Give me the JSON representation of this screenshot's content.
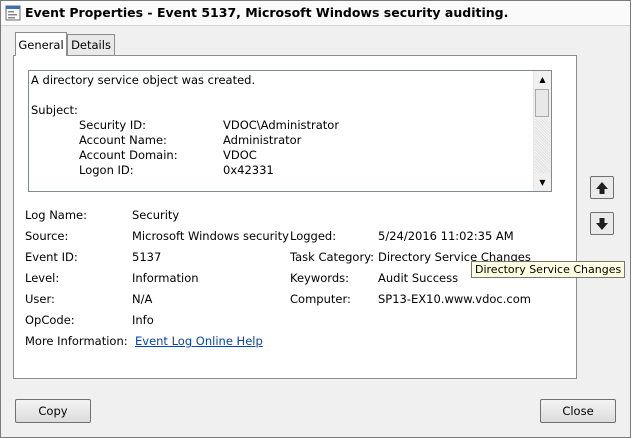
{
  "window": {
    "title": "Event Properties - Event 5137, Microsoft Windows security auditing."
  },
  "tabs": [
    {
      "label": "General"
    },
    {
      "label": "Details"
    }
  ],
  "description": {
    "lines": [
      {
        "text": "A directory service object was created."
      },
      {
        "text": ""
      },
      {
        "text": "Subject:"
      }
    ],
    "subject_fields": [
      {
        "label": "Security ID:",
        "value": "VDOC\\Administrator"
      },
      {
        "label": "Account Name:",
        "value": "Administrator"
      },
      {
        "label": "Account Domain:",
        "value": "VDOC"
      },
      {
        "label": "Logon ID:",
        "value": "0x42331"
      }
    ]
  },
  "fields": {
    "log_name": {
      "label": "Log Name:",
      "value": "Security"
    },
    "source": {
      "label": "Source:",
      "value": "Microsoft Windows security"
    },
    "logged": {
      "label": "Logged:",
      "value": "5/24/2016 11:02:35 AM"
    },
    "event_id": {
      "label": "Event ID:",
      "value": "5137"
    },
    "task_category": {
      "label": "Task Category:",
      "value": "Directory Service Changes"
    },
    "level": {
      "label": "Level:",
      "value": "Information"
    },
    "keywords": {
      "label": "Keywords:",
      "value": "Audit Success"
    },
    "user": {
      "label": "User:",
      "value": "N/A"
    },
    "computer": {
      "label": "Computer:",
      "value": "SP13-EX10.www.vdoc.com"
    },
    "opcode": {
      "label": "OpCode:",
      "value": "Info"
    },
    "more_info": {
      "label": "More Information:",
      "link": "Event Log Online Help"
    }
  },
  "tooltip": {
    "text": "Directory Service Changes"
  },
  "buttons": {
    "copy": "Copy",
    "close": "Close"
  }
}
